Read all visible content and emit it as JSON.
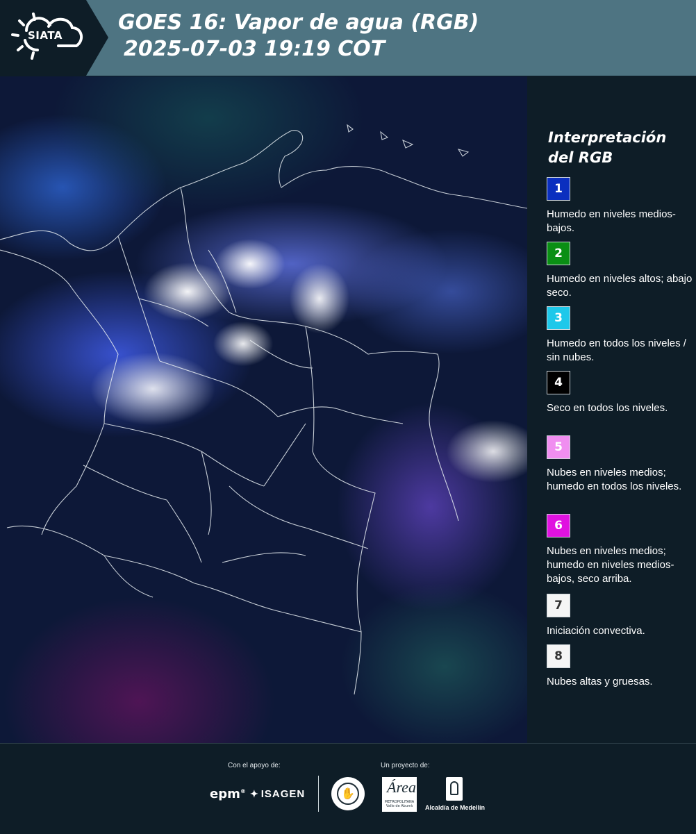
{
  "header": {
    "logo_text": "SIATA",
    "title_line1": "GOES 16: Vapor de agua (RGB)",
    "title_line2": "2025-07-03 19:19 COT"
  },
  "colors": {
    "header_bg": "#4e7482",
    "panel_bg": "#0e1d27",
    "logo_tab_bg": "#0e1d27"
  },
  "legend": {
    "title_line1": "Interpretación",
    "title_line2": "del RGB",
    "items": [
      {
        "number": "1",
        "color": "#0b2fbf",
        "text_color": "#ffffff",
        "label": "Humedo en niveles medios-bajos."
      },
      {
        "number": "2",
        "color": "#0a8f14",
        "text_color": "#ffffff",
        "label": "Humedo en niveles altos; abajo seco."
      },
      {
        "number": "3",
        "color": "#1ec8ea",
        "text_color": "#ffffff",
        "label": "Humedo en todos los niveles / sin nubes."
      },
      {
        "number": "4",
        "color": "#000000",
        "text_color": "#ffffff",
        "label": "Seco en todos los niveles."
      },
      {
        "number": "5",
        "color": "#f08ef0",
        "text_color": "#ffffff",
        "label": "Nubes en niveles medios; humedo en todos los niveles."
      },
      {
        "number": "6",
        "color": "#e012e0",
        "text_color": "#ffffff",
        "label": "Nubes en niveles medios; humedo en niveles medios-bajos, seco arriba."
      },
      {
        "number": "7",
        "color": "#f5f5f5",
        "text_color": "#333333",
        "label": "Iniciación convectiva."
      },
      {
        "number": "8",
        "color": "#f5f5f5",
        "text_color": "#333333",
        "label": "Nubes altas y gruesas."
      }
    ]
  },
  "footer": {
    "support_label": "Con el apoyo de:",
    "project_label": "Un proyecto de:",
    "epm": "epm",
    "isagen": "ISAGEN",
    "area_big": "Área",
    "area_small": "METROPOLITANA Valle de Aburrá",
    "alcaldia": "Alcaldía de Medellín"
  }
}
